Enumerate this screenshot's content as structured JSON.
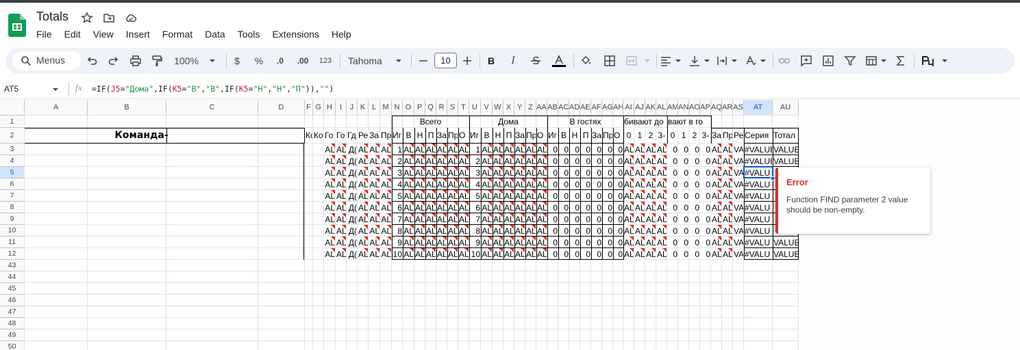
{
  "app": {
    "title": "Totals"
  },
  "menu": [
    "File",
    "Edit",
    "View",
    "Insert",
    "Format",
    "Data",
    "Tools",
    "Extensions",
    "Help"
  ],
  "toolbar": {
    "search_label": "Menus",
    "zoom": "100%",
    "currency": "$",
    "percent": "%",
    "dec_decrease": ".0",
    "dec_increase": ".00",
    "number_format": "123",
    "font": "Tahoma",
    "font_size": "10",
    "bold": "B",
    "italic": "I"
  },
  "formula_bar": {
    "name_box": "AT5",
    "fx": "fx",
    "formula": "=IF(J5=\"Дома\",IF(K5=\"В\",\"В\",IF(K5=\"Н\",\"Н\",\"П\")),\"\")"
  },
  "columns": [
    "A",
    "B",
    "C",
    "D",
    "F",
    "G",
    "H",
    "I",
    "J",
    "K",
    "L",
    "M",
    "N",
    "O",
    "P",
    "Q",
    "R",
    "S",
    "T",
    "U",
    "V",
    "W",
    "X",
    "Y",
    "Z",
    "AA",
    "AB",
    "AC",
    "AD",
    "AE",
    "AF",
    "AG",
    "AH",
    "AI",
    "AJ",
    "AK",
    "AL",
    "AM",
    "AN",
    "AO",
    "AP",
    "AQ",
    "AR",
    "AS",
    "AT",
    "AU"
  ],
  "rows": [
    "1",
    "2",
    "3",
    "4",
    "5",
    "6",
    "7",
    "8",
    "9",
    "10",
    "11",
    "12",
    "43",
    "44",
    "45",
    "46",
    "47",
    "48",
    "49",
    "50"
  ],
  "sheet": {
    "team_header": "Команда-",
    "group_total": "Всего",
    "group_home": "Дома",
    "group_away": "В гостях",
    "group_scored": "бивают до",
    "group_conceded": "вают в го",
    "row2_F": "Ко",
    "row2_G": "Ко",
    "row2_H": "Го",
    "row2_I": "Го",
    "row2_J": "Гд",
    "row2_K": "Ре",
    "row2_L": "За",
    "row2_M": "Пр",
    "row2_N": "Иг",
    "row2_O": "В",
    "row2_P": "Н",
    "row2_Q": "П",
    "row2_R": "За",
    "row2_S": "Пр",
    "row2_T": "О",
    "row2_U": "Иг",
    "row2_V": "В",
    "row2_W": "Н",
    "row2_X": "П",
    "row2_Y": "За",
    "row2_Z": "Пр",
    "row2_AA": "О",
    "row2_AB": "Иг",
    "row2_AC": "В",
    "row2_AD": "Н",
    "row2_AE": "П",
    "row2_AF": "За",
    "row2_AG": "Пр",
    "row2_AH": "О",
    "row2_AI": "0",
    "row2_AJ": "1",
    "row2_AK": "2",
    "row2_AL": "3-",
    "row2_AM": "0",
    "row2_AN": "1",
    "row2_AO": "2",
    "row2_AP": "3-",
    "row2_AQ": "За",
    "row2_AR": "Пр",
    "row2_AS": "Ре",
    "row2_AT": "Серия",
    "row2_AU": "Тотал",
    "err_val": "AL",
    "j_val": "Д(",
    "match_nums": [
      "1",
      "2",
      "3",
      "4",
      "5",
      "6",
      "7",
      "8",
      "9",
      "10"
    ],
    "zero": "0",
    "as_val": "VAL",
    "at_vals": [
      "#VALUE",
      "#VALUE",
      "#VALU",
      "#VALU",
      "#VALU",
      "#VALU",
      "#VALU",
      "#VALU",
      "#VALU",
      "#VALU"
    ],
    "au_vals": [
      "VALUE",
      "VALUE",
      "",
      "",
      "",
      "",
      "",
      "",
      "VALUE",
      "VALUE"
    ]
  },
  "error_popup": {
    "title": "Error",
    "message": "Function FIND parameter 2 value should be non-empty."
  },
  "colors": {
    "accent": "#0b57d0",
    "error": "#d93025",
    "sheets_green": "#0f9d58"
  }
}
